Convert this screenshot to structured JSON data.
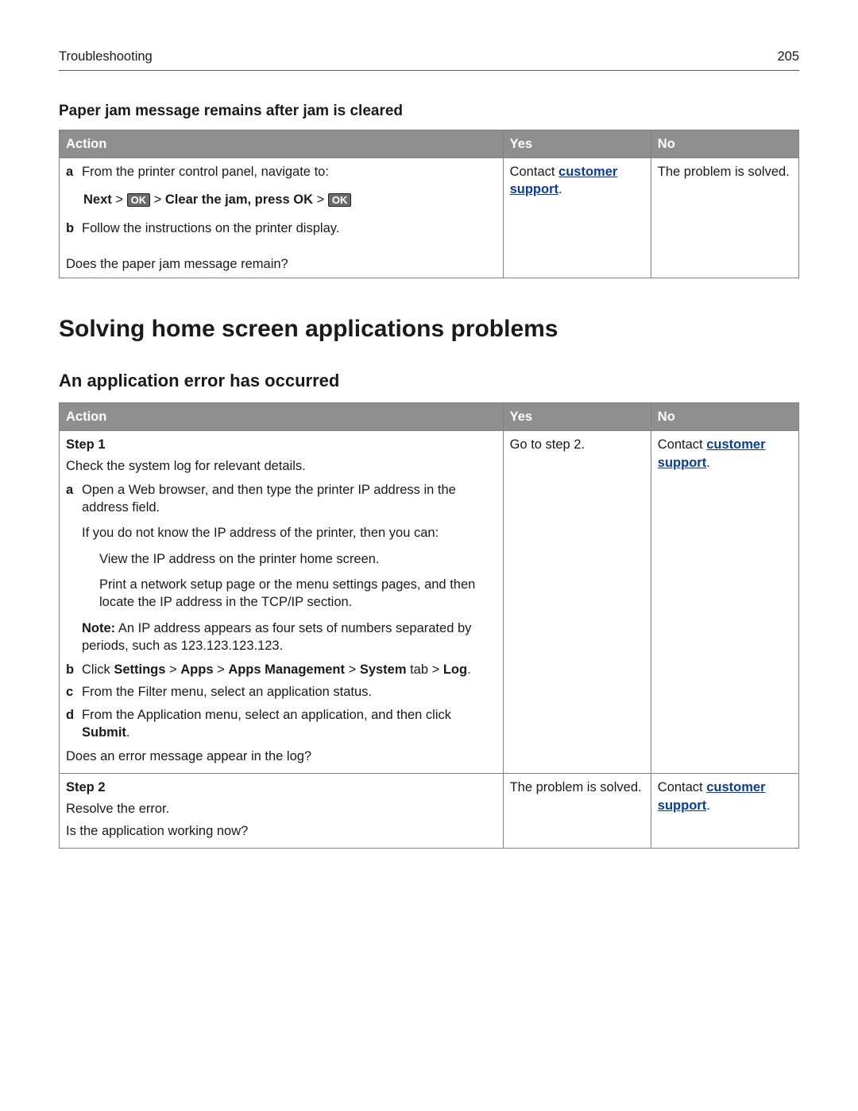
{
  "header": {
    "left": "Troubleshooting",
    "right": "205"
  },
  "table1": {
    "title": "Paper jam message remains after jam is cleared",
    "headers": {
      "action": "Action",
      "yes": "Yes",
      "no": "No"
    },
    "row": {
      "a_text": "From the printer control panel, navigate to:",
      "nav_next": "Next",
      "nav_gt1": " > ",
      "nav_ok1": "OK",
      "nav_gt2": " > ",
      "nav_clear": "Clear the jam, press OK",
      "nav_gt3": " > ",
      "nav_ok2": "OK",
      "b_text": "Follow the instructions on the printer display.",
      "question": "Does the paper jam message remain?",
      "yes_pre": "Contact ",
      "yes_link": "customer support",
      "yes_post": ".",
      "no_text": "The problem is solved."
    }
  },
  "sectionTitle": "Solving home screen applications problems",
  "subTitle": "An application error has occurred",
  "table2": {
    "headers": {
      "action": "Action",
      "yes": "Yes",
      "no": "No"
    },
    "row1": {
      "step": "Step 1",
      "intro": "Check the system log for relevant details.",
      "a": "Open a Web browser, and then type the printer IP address in the address field.",
      "a_if": "If you do not know the IP address of the printer, then you can:",
      "a_opt1": "View the IP address on the printer home screen.",
      "a_opt2": "Print a network setup page or the menu settings pages, and then locate the IP address in the TCP/IP section.",
      "a_note_b": "Note:",
      "a_note": " An IP address appears as four sets of numbers separated by periods, such as 123.123.123.123.",
      "b_pre": "Click ",
      "b_s": "Settings",
      "b_g1": " > ",
      "b_a": "Apps",
      "b_g2": " > ",
      "b_am": "Apps Management",
      "b_g3": " > ",
      "b_sy": "System",
      "b_tab": " tab > ",
      "b_log": "Log",
      "b_post": ".",
      "c": "From the Filter menu, select an application status.",
      "d_pre": "From the Application menu, select an application, and then click ",
      "d_sub": "Submit",
      "d_post": ".",
      "question": "Does an error message appear in the log?",
      "yes": "Go to step 2.",
      "no_pre": "Contact ",
      "no_link": "customer support",
      "no_post": "."
    },
    "row2": {
      "step": "Step 2",
      "intro": "Resolve the error.",
      "question": "Is the application working now?",
      "yes": "The problem is solved.",
      "no_pre": "Contact ",
      "no_link": "customer support",
      "no_post": "."
    }
  },
  "letters": {
    "a": "a",
    "b": "b",
    "c": "c",
    "d": "d"
  }
}
